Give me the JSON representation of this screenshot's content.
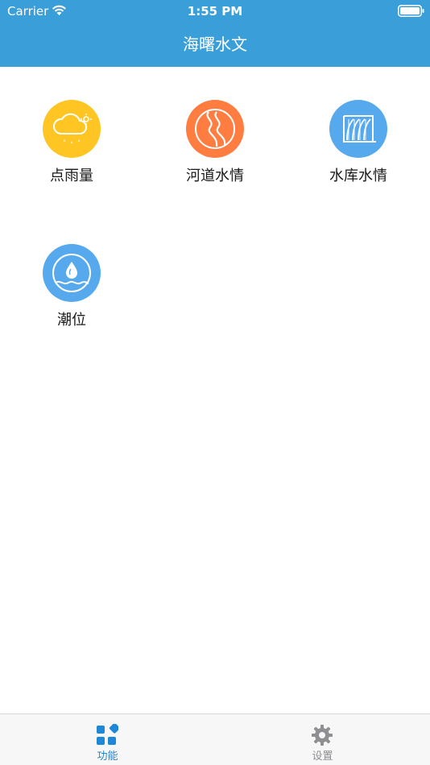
{
  "status_bar": {
    "carrier": "Carrier",
    "time": "1:55 PM"
  },
  "nav": {
    "title": "海曙水文"
  },
  "features": [
    {
      "label": "点雨量",
      "icon": "rain-cloud-icon",
      "color": "#ffc522"
    },
    {
      "label": "河道水情",
      "icon": "river-icon",
      "color": "#ff7d41"
    },
    {
      "label": "水库水情",
      "icon": "reservoir-icon",
      "color": "#55a9ec"
    },
    {
      "label": "潮位",
      "icon": "water-drop-icon",
      "color": "#55a9ec"
    }
  ],
  "tabs": [
    {
      "label": "功能",
      "icon": "grid-icon",
      "active": true,
      "color": "#1e87d6"
    },
    {
      "label": "设置",
      "icon": "gear-icon",
      "active": false,
      "color": "#8e8e93"
    }
  ]
}
